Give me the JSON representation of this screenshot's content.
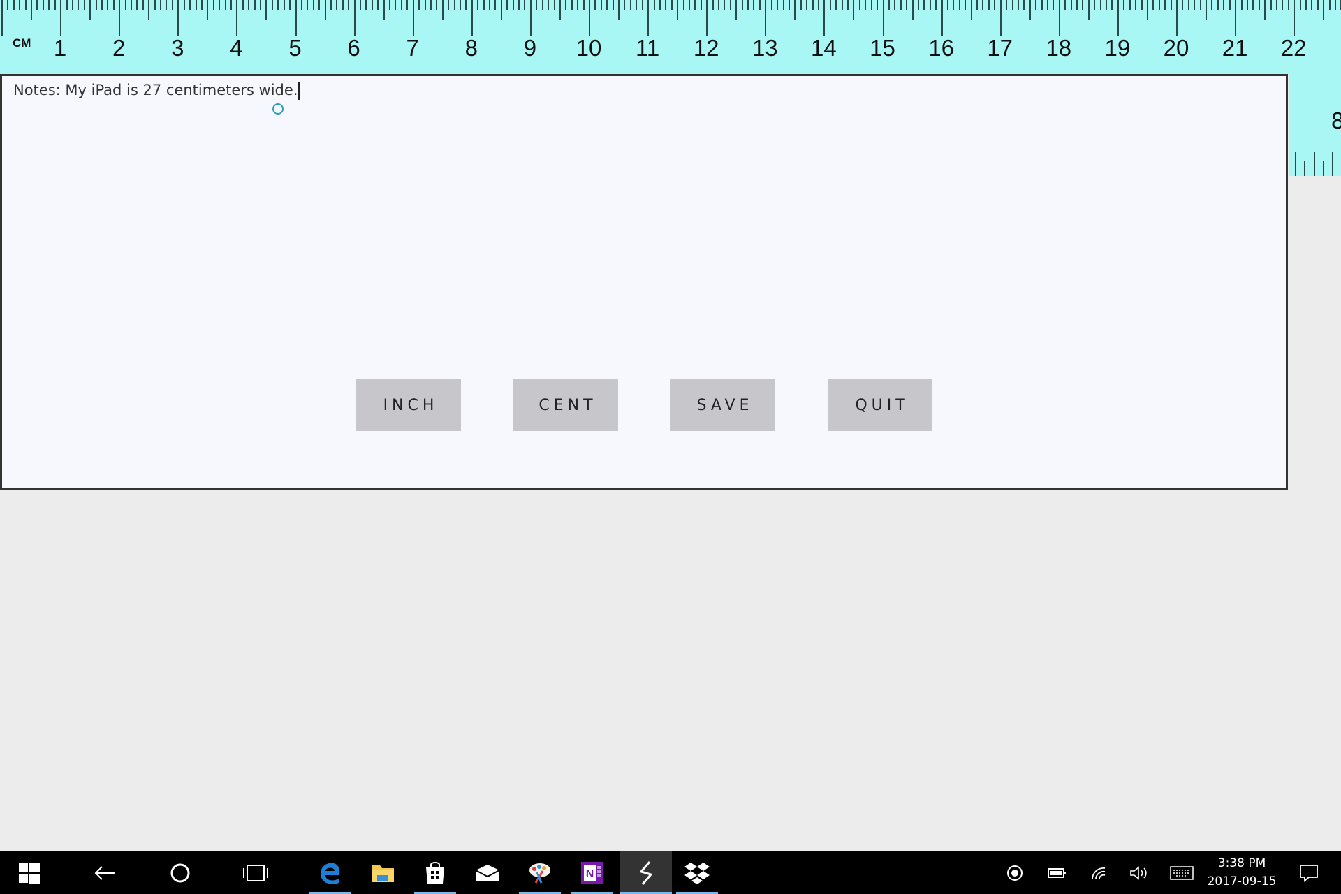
{
  "ruler": {
    "unit_label": "CM",
    "cm_numbers": [
      "1",
      "2",
      "3",
      "4",
      "5",
      "6",
      "7",
      "8",
      "9",
      "10",
      "11",
      "12",
      "13",
      "14",
      "15",
      "16",
      "17",
      "18",
      "19",
      "20",
      "21",
      "22"
    ],
    "inch_number": "8"
  },
  "notes": {
    "text": "Notes: My iPad is 27 centimeters wide."
  },
  "buttons": {
    "inch": "INCH",
    "cent": "CENT",
    "save": "SAVE",
    "quit": "QUIT"
  },
  "taskbar": {
    "apps": [
      "start-icon",
      "back-icon",
      "cortana-icon",
      "task-view-icon",
      "edge-icon",
      "file-explorer-icon",
      "store-icon",
      "mail-icon",
      "paint-icon",
      "onenote-icon",
      "ruler-app-icon",
      "dropbox-icon"
    ],
    "tray": [
      "record-icon",
      "battery-icon",
      "wifi-icon",
      "volume-icon",
      "keyboard-icon",
      "notification-icon"
    ],
    "time": "3:38 PM",
    "date": "2017-09-15"
  },
  "colors": {
    "ruler": "#a9f7f4",
    "window": "#f7f8fd",
    "button": "#c6c6cb",
    "taskbar": "#000000",
    "accent": "#76b9ed"
  }
}
